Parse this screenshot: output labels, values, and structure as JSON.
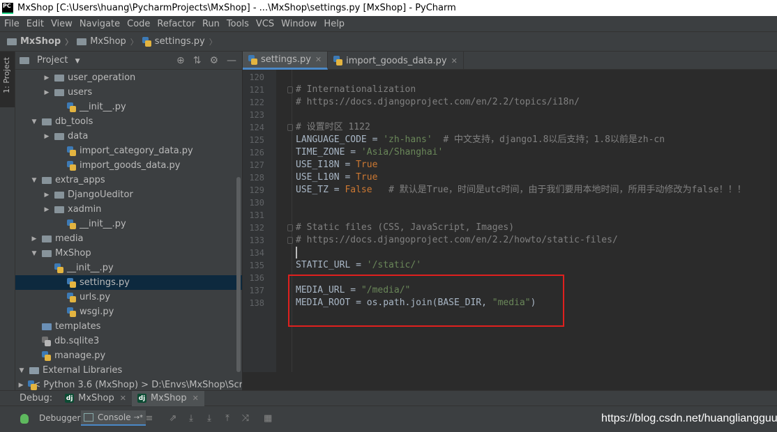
{
  "title_bar": {
    "logo": "PC",
    "text": "MxShop [C:\\Users\\huang\\PycharmProjects\\MxShop] - ...\\MxShop\\settings.py [MxShop] - PyCharm"
  },
  "menu": [
    "File",
    "Edit",
    "View",
    "Navigate",
    "Code",
    "Refactor",
    "Run",
    "Tools",
    "VCS",
    "Window",
    "Help"
  ],
  "breadcrumb": [
    "MxShop",
    "MxShop",
    "settings.py"
  ],
  "left_strip": {
    "tab": "1: Project"
  },
  "project": {
    "title": "Project",
    "tree": [
      {
        "label": "user_operation",
        "kind": "folder",
        "arrow": "▶"
      },
      {
        "label": "users",
        "kind": "folder",
        "arrow": "▶"
      },
      {
        "label": "__init__.py",
        "kind": "py",
        "arrow": ""
      },
      {
        "label": "db_tools",
        "kind": "folder",
        "arrow": "▼"
      },
      {
        "label": "data",
        "kind": "folder",
        "arrow": "▶"
      },
      {
        "label": "import_category_data.py",
        "kind": "py",
        "arrow": ""
      },
      {
        "label": "import_goods_data.py",
        "kind": "py",
        "arrow": ""
      },
      {
        "label": "extra_apps",
        "kind": "folder-blue",
        "arrow": "▼"
      },
      {
        "label": "DjangoUeditor",
        "kind": "folder",
        "arrow": "▶"
      },
      {
        "label": "xadmin",
        "kind": "folder",
        "arrow": "▶"
      },
      {
        "label": "__init__.py",
        "kind": "py",
        "arrow": ""
      },
      {
        "label": "media",
        "kind": "folder",
        "arrow": "▶"
      },
      {
        "label": "MxShop",
        "kind": "folder",
        "arrow": "▼"
      },
      {
        "label": "__init__.py",
        "kind": "py",
        "arrow": ""
      },
      {
        "label": "settings.py",
        "kind": "py",
        "arrow": "",
        "selected": true
      },
      {
        "label": "urls.py",
        "kind": "py",
        "arrow": ""
      },
      {
        "label": "wsgi.py",
        "kind": "py",
        "arrow": ""
      },
      {
        "label": "templates",
        "kind": "folder-yellow",
        "arrow": ""
      },
      {
        "label": "db.sqlite3",
        "kind": "db",
        "arrow": ""
      },
      {
        "label": "manage.py",
        "kind": "py",
        "arrow": ""
      },
      {
        "label": "External Libraries",
        "kind": "lib",
        "arrow": "▼"
      },
      {
        "label": "< Python 3.6 (MxShop) >  D:\\Envs\\MxShop\\Scr",
        "kind": "py",
        "arrow": "▶"
      }
    ]
  },
  "editor": {
    "tabs": [
      {
        "label": "settings.py",
        "active": true
      },
      {
        "label": "import_goods_data.py",
        "active": false
      }
    ],
    "lines": [
      {
        "n": "120",
        "code": []
      },
      {
        "n": "121",
        "code": [
          [
            "cm",
            "# Internationalization"
          ]
        ]
      },
      {
        "n": "122",
        "code": [
          [
            "cm",
            "# https://docs.djangoproject.com/en/2.2/topics/i18n/"
          ]
        ]
      },
      {
        "n": "123",
        "code": []
      },
      {
        "n": "124",
        "code": [
          [
            "cm",
            "# 设置时区 1122"
          ]
        ]
      },
      {
        "n": "125",
        "code": [
          [
            "tx",
            "LANGUAGE_CODE = "
          ],
          [
            "st",
            "'zh-hans'"
          ],
          [
            "cm",
            "  # 中文支持，django1.8以后支持；1.8以前是zh-cn"
          ]
        ]
      },
      {
        "n": "126",
        "code": [
          [
            "tx",
            "TIME_ZONE = "
          ],
          [
            "st",
            "'Asia/Shanghai'"
          ]
        ]
      },
      {
        "n": "127",
        "code": [
          [
            "tx",
            "USE_I18N = "
          ],
          [
            "kw",
            "True"
          ]
        ]
      },
      {
        "n": "128",
        "code": [
          [
            "tx",
            "USE_L10N = "
          ],
          [
            "kw",
            "True"
          ]
        ]
      },
      {
        "n": "129",
        "code": [
          [
            "tx",
            "USE_TZ = "
          ],
          [
            "kw",
            "False"
          ],
          [
            "cm",
            "   # 默认是True，时间是utc时间，由于我们要用本地时间，所用手动修改为false！！！"
          ]
        ]
      },
      {
        "n": "130",
        "code": []
      },
      {
        "n": "131",
        "code": []
      },
      {
        "n": "132",
        "code": [
          [
            "cm",
            "# Static files (CSS, JavaScript, Images)"
          ]
        ]
      },
      {
        "n": "133",
        "code": [
          [
            "cm",
            "# https://docs.djangoproject.com/en/2.2/howto/static-files/"
          ]
        ]
      },
      {
        "n": "134",
        "code": []
      },
      {
        "n": "135",
        "code": [
          [
            "tx",
            "STATIC_URL = "
          ],
          [
            "st",
            "'/static/'"
          ]
        ]
      },
      {
        "n": "136",
        "code": []
      },
      {
        "n": "137",
        "code": [
          [
            "tx",
            "MEDIA_URL = "
          ],
          [
            "st",
            "\"/media/\""
          ]
        ]
      },
      {
        "n": "138",
        "code": [
          [
            "tx",
            "MEDIA_ROOT = os.path.join(BASE_DIR, "
          ],
          [
            "st",
            "\"media\""
          ],
          [
            "tx",
            ")"
          ]
        ]
      }
    ]
  },
  "debug": {
    "label": "Debug:",
    "tabs": [
      {
        "label": "MxShop",
        "active": false
      },
      {
        "label": "MxShop",
        "active": true
      }
    ],
    "toolbar": {
      "debugger_label": "Debugger",
      "console_label": "Console",
      "console_suffix": "→*"
    }
  },
  "watermark": "https://blog.csdn.net/huangliangguu",
  "colors": {
    "accent": "#4a88c7",
    "highlight_box": "#e0201e",
    "selection": "#0d293e"
  }
}
